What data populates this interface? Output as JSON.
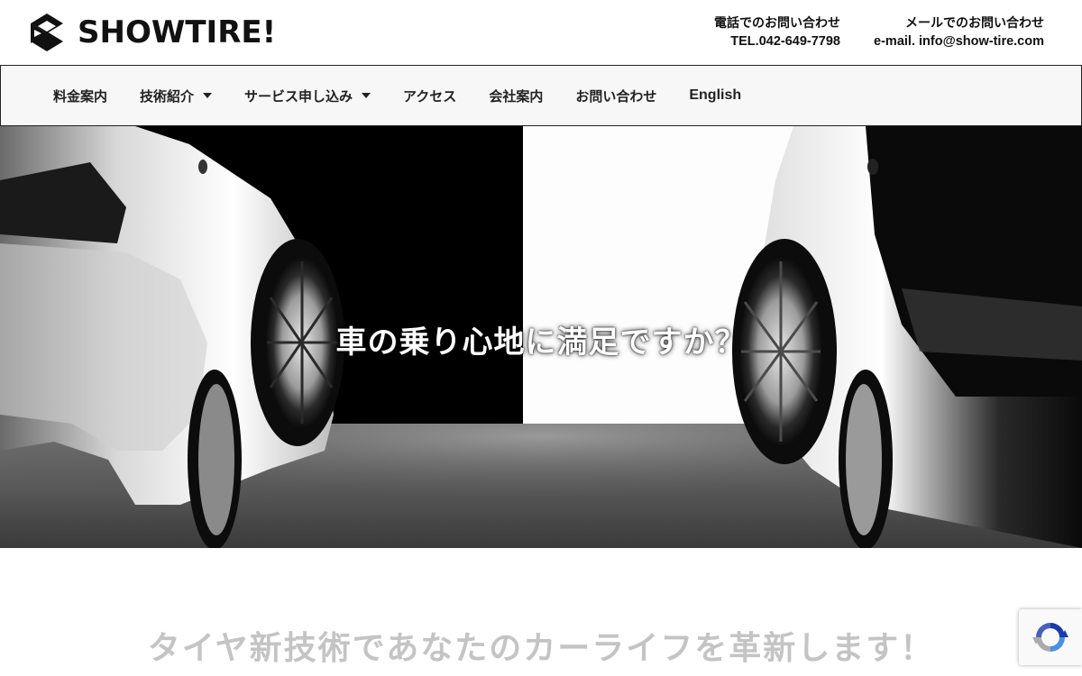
{
  "brand": {
    "name": "SHOWTIRE!",
    "logo_icon": "showtire-logo-icon"
  },
  "contact": {
    "phone_label": "電話でのお問い合わせ",
    "phone_value": "TEL.042-649-7798",
    "mail_label": "メールでのお問い合わせ",
    "mail_value": "e-mail. info@show-tire.com"
  },
  "nav": {
    "items": [
      {
        "label": "料金案内"
      },
      {
        "label": "技術紹介",
        "dropdown": true
      },
      {
        "label": "サービス申し込み",
        "dropdown": true
      },
      {
        "label": "アクセス"
      },
      {
        "label": "会社案内"
      },
      {
        "label": "お問い合わせ"
      },
      {
        "label": "English"
      }
    ]
  },
  "hero": {
    "headline": "車の乗り心地に満足ですか？"
  },
  "intro": {
    "heading": "タイヤ新技術であなたのカーライフを革新します！"
  },
  "recaptcha": {
    "icon": "recaptcha-icon"
  },
  "colors": {
    "nav_background": "#f7f7f7",
    "heading_gray": "#c4c4c4",
    "text": "#111111"
  }
}
